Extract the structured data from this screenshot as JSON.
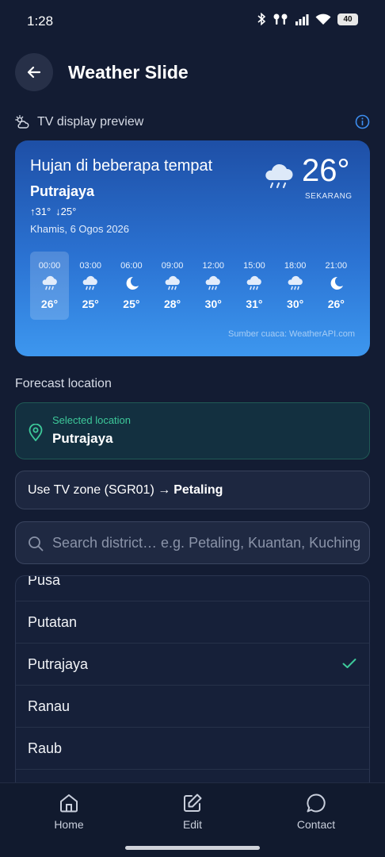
{
  "status": {
    "time": "1:28",
    "battery": "40"
  },
  "header": {
    "title": "Weather Slide"
  },
  "preview": {
    "label": "TV display preview",
    "condition": "Hujan di beberapa tempat",
    "city": "Putrajaya",
    "high": "↑31°",
    "low": "↓25°",
    "date": "Khamis, 6 Ogos 2026",
    "now_temp": "26°",
    "now_label": "SEKARANG",
    "now_icon": "rain-cloud-icon",
    "hours": [
      {
        "time": "00:00",
        "temp": "26°",
        "icon": "rain-cloud-icon"
      },
      {
        "time": "03:00",
        "temp": "25°",
        "icon": "rain-cloud-icon"
      },
      {
        "time": "06:00",
        "temp": "25°",
        "icon": "moon-icon"
      },
      {
        "time": "09:00",
        "temp": "28°",
        "icon": "rain-cloud-icon"
      },
      {
        "time": "12:00",
        "temp": "30°",
        "icon": "rain-cloud-icon"
      },
      {
        "time": "15:00",
        "temp": "31°",
        "icon": "rain-cloud-icon"
      },
      {
        "time": "18:00",
        "temp": "30°",
        "icon": "rain-cloud-icon"
      },
      {
        "time": "21:00",
        "temp": "26°",
        "icon": "moon-icon"
      }
    ],
    "source": "Sumber cuaca: WeatherAPI.com"
  },
  "forecast": {
    "label": "Forecast location",
    "selected_small": "Selected location",
    "selected_city": "Putrajaya",
    "tvzone_prefix": "Use TV zone (SGR01) →",
    "tvzone_target": "Petaling",
    "search_placeholder": "Search district… e.g. Petaling, Kuantan, Kuching",
    "list": [
      {
        "label": "Pusa",
        "selected": false
      },
      {
        "label": "Putatan",
        "selected": false
      },
      {
        "label": "Putrajaya",
        "selected": true
      },
      {
        "label": "Ranau",
        "selected": false
      },
      {
        "label": "Raub",
        "selected": false
      }
    ]
  },
  "nav": {
    "home": "Home",
    "edit": "Edit",
    "contact": "Contact"
  },
  "colors": {
    "accent_green": "#3dc99a",
    "card_top": "#1e4fa6",
    "card_bottom": "#3d97ef",
    "background": "#131c33"
  }
}
